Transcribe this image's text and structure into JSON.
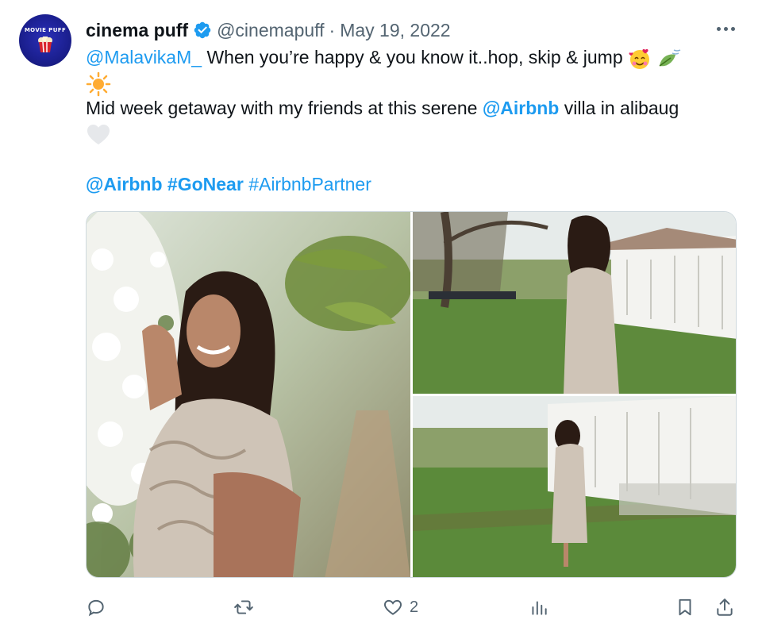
{
  "author": {
    "name": "cinema puff",
    "handle": "@cinemapuff",
    "separator": "·",
    "date": "May 19, 2022",
    "avatar_text": "MOVIE PUFF",
    "verified": true
  },
  "tweet": {
    "line1": {
      "mention": "@MalavikaM_",
      "text": " When you’re happy & you know it..hop, skip & jump "
    },
    "line3": {
      "text_before": "Mid week getaway with my friends at this serene ",
      "mention": "@Airbnb",
      "text_after": " villa in alibaug"
    },
    "tags": {
      "mention": "@Airbnb",
      "hashtag1": "#GoNear",
      "hashtag2": "#AirbnbPartner"
    }
  },
  "media": {
    "count": 3,
    "descriptions": []
  },
  "actions": {
    "reply_count": "",
    "retweet_count": "",
    "like_count": "2",
    "views_count": ""
  },
  "colors": {
    "link": "#1d9bf0",
    "muted": "#536471",
    "text": "#0f1419",
    "verified": "#1d9bf0"
  },
  "icons": [
    "more-icon",
    "verified-badge-icon",
    "reply-icon",
    "retweet-icon",
    "like-icon",
    "views-icon",
    "bookmark-icon",
    "share-icon"
  ]
}
